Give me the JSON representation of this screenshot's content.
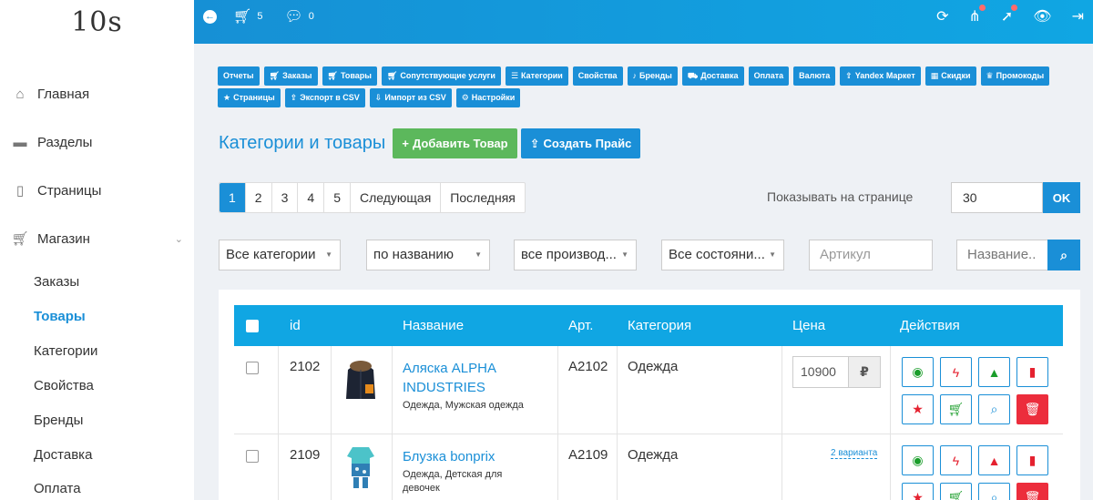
{
  "app": {
    "logo": "10s"
  },
  "sidebar": {
    "items": [
      {
        "label": "Главная",
        "icon": "home-icon"
      },
      {
        "label": "Разделы",
        "icon": "folder-icon"
      },
      {
        "label": "Страницы",
        "icon": "file-icon"
      },
      {
        "label": "Магазин",
        "icon": "cart-icon"
      }
    ],
    "sub_items": [
      {
        "label": "Заказы",
        "active": false
      },
      {
        "label": "Товары",
        "active": true
      },
      {
        "label": "Категории",
        "active": false
      },
      {
        "label": "Свойства",
        "active": false
      },
      {
        "label": "Бренды",
        "active": false
      },
      {
        "label": "Доставка",
        "active": false
      },
      {
        "label": "Оплата",
        "active": false
      }
    ]
  },
  "topbar": {
    "cart_count": "5",
    "comments_count": "0"
  },
  "menu": [
    {
      "label": "Отчеты",
      "icon": ""
    },
    {
      "label": "Заказы",
      "icon": "cart-icon"
    },
    {
      "label": "Товары",
      "icon": "cart-icon"
    },
    {
      "label": "Сопутствующие услуги",
      "icon": "cart-icon"
    },
    {
      "label": "Категории",
      "icon": "list-icon"
    },
    {
      "label": "Свойства",
      "icon": ""
    },
    {
      "label": "Бренды",
      "icon": "bell-icon"
    },
    {
      "label": "Доставка",
      "icon": "truck-icon"
    },
    {
      "label": "Оплата",
      "icon": ""
    },
    {
      "label": "Валюта",
      "icon": ""
    },
    {
      "label": "Yandex Маркет",
      "icon": "upload-icon"
    },
    {
      "label": "Скидки",
      "icon": "building-icon"
    },
    {
      "label": "Промокоды",
      "icon": "trophy-icon"
    },
    {
      "label": "Страницы",
      "icon": "star-icon"
    },
    {
      "label": "Экспорт в CSV",
      "icon": "upload-icon"
    },
    {
      "label": "Импорт из CSV",
      "icon": "download-icon"
    },
    {
      "label": "Настройки",
      "icon": "gear-icon"
    }
  ],
  "heading": {
    "title": "Категории и товары",
    "add_button": "Добавить Товар",
    "price_button": "Создать Прайс"
  },
  "pagination": {
    "pages": [
      "1",
      "2",
      "3",
      "4",
      "5"
    ],
    "current": "1",
    "next": "Следующая",
    "last": "Последняя",
    "per_page_label": "Показывать на странице",
    "per_page_value": "30",
    "ok": "OK"
  },
  "filters": {
    "category": "Все категории",
    "sort": "по названию",
    "manufacturer": "все производ...",
    "state": "Все состояни...",
    "article_placeholder": "Артикул",
    "name_placeholder": "Название.."
  },
  "table": {
    "headers": {
      "id": "id",
      "name": "Название",
      "art": "Арт.",
      "category": "Категория",
      "price": "Цена",
      "actions": "Действия"
    },
    "rows": [
      {
        "id": "2102",
        "name": "Аляска ALPHA INDUSTRIES",
        "categories": "Одежда, Мужская одежда",
        "art": "A2102",
        "category": "Одежда",
        "price": "10900",
        "currency": "₽",
        "variants": ""
      },
      {
        "id": "2109",
        "name": "Блузка bonprix",
        "categories": "Одежда, Детская для девочек",
        "art": "A2109",
        "category": "Одежда",
        "price": "",
        "currency": "",
        "variants": "2 варианта"
      }
    ]
  },
  "colors": {
    "accent": "#1a8fd7",
    "header_bar": "#10a6e3",
    "success": "#5cb85c",
    "danger": "#ec2d3c"
  }
}
